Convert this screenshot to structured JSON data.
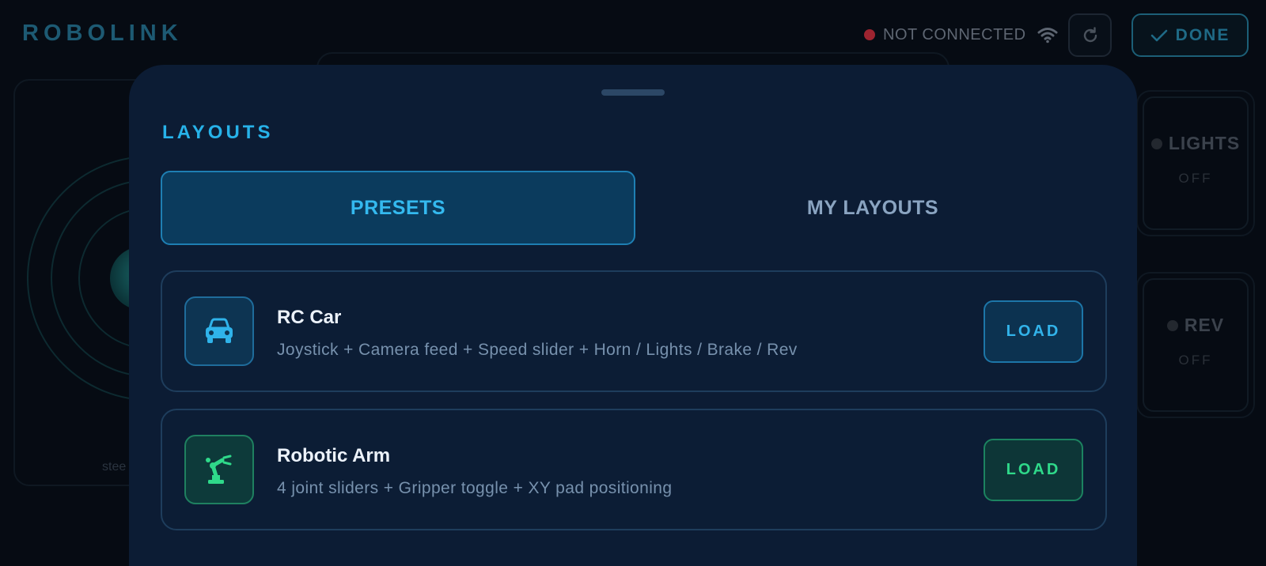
{
  "app": {
    "brand": "ROBOLINK",
    "status": "NOT CONNECTED",
    "done_label": "DONE",
    "steer_label": "stee",
    "status_color": "#9e2430"
  },
  "tiles": [
    {
      "label": "LIGHTS",
      "state": "OFF"
    },
    {
      "label": "REV",
      "state": "OFF"
    }
  ],
  "sheet": {
    "title": "LAYOUTS",
    "tabs": [
      {
        "label": "PRESETS",
        "active": true
      },
      {
        "label": "MY LAYOUTS",
        "active": false
      }
    ],
    "presets": [
      {
        "name": "RC Car",
        "description": "Joystick + Camera feed + Speed slider + Horn / Lights / Brake / Rev",
        "icon": "car-icon",
        "accent": "#2fb3ea",
        "action": "LOAD"
      },
      {
        "name": "Robotic Arm",
        "description": "4 joint sliders + Gripper toggle + XY pad positioning",
        "icon": "robotic-arm-icon",
        "accent": "#2fd98a",
        "action": "LOAD"
      }
    ]
  }
}
